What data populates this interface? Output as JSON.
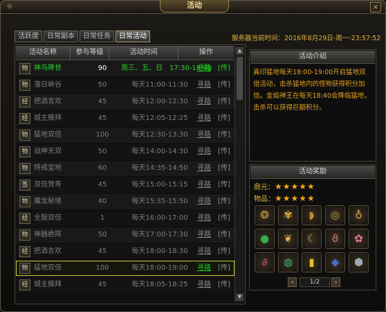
{
  "window": {
    "title": "活动",
    "close_label": "×"
  },
  "tabs": [
    {
      "label": "活跃度",
      "active": false
    },
    {
      "label": "日常副本",
      "active": false
    },
    {
      "label": "日常任务",
      "active": false
    },
    {
      "label": "日常活动",
      "active": true
    }
  ],
  "server_time": "服务器当前时间：2016年8月29日-周一-23:57:52",
  "list": {
    "headers": [
      "活动名称",
      "参与等级",
      "活动时间",
      "操作"
    ],
    "rows": [
      {
        "icon": "物",
        "name": "神鸟降世",
        "level": "90",
        "time": "周三、五、日　17:30-18:00",
        "find": "寻路",
        "send": "[传]",
        "state": "active"
      },
      {
        "icon": "物",
        "name": "落日峡谷",
        "level": "50",
        "time": "每天11:00-11:30",
        "find": "寻路",
        "send": "[传]",
        "state": "normal"
      },
      {
        "icon": "经",
        "name": "把酒言欢",
        "level": "45",
        "time": "每天12:00-12:30",
        "find": "寻路",
        "send": "[传]",
        "state": "normal"
      },
      {
        "icon": "经",
        "name": "城主膜拜",
        "level": "45",
        "time": "每天12:05-12:25",
        "find": "寻路",
        "send": "[传]",
        "state": "normal"
      },
      {
        "icon": "物",
        "name": "猛地双倍",
        "level": "100",
        "time": "每天12:30-13:30",
        "find": "寻路",
        "send": "[传]",
        "state": "normal"
      },
      {
        "icon": "物",
        "name": "战神无双",
        "level": "50",
        "time": "每天14:00-14:30",
        "find": "寻路",
        "send": "[传]",
        "state": "normal"
      },
      {
        "icon": "物",
        "name": "特戒宝地",
        "level": "60",
        "time": "每天14:35-14:50",
        "find": "寻路",
        "send": "[传]",
        "state": "normal"
      },
      {
        "icon": "签",
        "name": "双倍贺寿",
        "level": "45",
        "time": "每天15:00-15:15",
        "find": "寻路",
        "send": "[传]",
        "state": "normal"
      },
      {
        "icon": "物",
        "name": "魔龙秘境",
        "level": "40",
        "time": "每天15:35-15:50",
        "find": "寻路",
        "send": "[传]",
        "state": "normal"
      },
      {
        "icon": "经",
        "name": "全服双倍",
        "level": "1",
        "time": "每天16:00-17:00",
        "find": "寻路",
        "send": "[传]",
        "state": "normal"
      },
      {
        "icon": "物",
        "name": "神器绝阵",
        "level": "50",
        "time": "每天17:00-17:30",
        "find": "寻路",
        "send": "[传]",
        "state": "normal"
      },
      {
        "icon": "经",
        "name": "把酒言欢",
        "level": "45",
        "time": "每天18:00-18:30",
        "find": "寻路",
        "send": "[传]",
        "state": "normal"
      },
      {
        "icon": "物",
        "name": "猛地双倍",
        "level": "100",
        "time": "每天18:00-19:00",
        "find": "寻路",
        "send": "[传]",
        "state": "selected"
      },
      {
        "icon": "经",
        "name": "城主膜拜",
        "level": "45",
        "time": "每天18:05-18:25",
        "find": "寻路",
        "send": "[传]",
        "state": "normal"
      }
    ],
    "scroll_up": "▲",
    "scroll_down": "▼"
  },
  "intro": {
    "title": "活动介绍",
    "text": "真印猛地每天18:00-19:00开启猛地双倍活动，击杀猛地内的怪物获得积分加倍。金焰神王在每天18:40会降临猛地，击杀可以获得巨额积分。"
  },
  "reward": {
    "title": "活动奖励",
    "ratings": [
      {
        "label": "鼎元：",
        "stars": "★★★★★",
        "value": 5
      },
      {
        "label": "物品：",
        "stars": "★★★★★",
        "value": 5
      }
    ],
    "items": [
      {
        "icon": "amulet-icon",
        "glyph": "❂",
        "color": "#c99a3c"
      },
      {
        "icon": "gold-wing-icon",
        "glyph": "✾",
        "color": "#e0b23e"
      },
      {
        "icon": "bow-icon",
        "glyph": "◗",
        "color": "#c88a3a"
      },
      {
        "icon": "ring-icon",
        "glyph": "◎",
        "color": "#c8a04a"
      },
      {
        "icon": "necklace-icon",
        "glyph": "♁",
        "color": "#d6a94a"
      },
      {
        "icon": "green-orb-icon",
        "glyph": "●",
        "color": "#2fb04a"
      },
      {
        "icon": "wing-charm-icon",
        "glyph": "❦",
        "color": "#e2b455"
      },
      {
        "icon": "crescent-icon",
        "glyph": "☾",
        "color": "#c9a06a"
      },
      {
        "icon": "pink-pendant-icon",
        "glyph": "ϑ",
        "color": "#d8707a"
      },
      {
        "icon": "pink-flower-icon",
        "glyph": "✿",
        "color": "#e37aa8"
      },
      {
        "icon": "red-necklace-icon",
        "glyph": "∂",
        "color": "#d8506a"
      },
      {
        "icon": "green-gem-icon",
        "glyph": "◍",
        "color": "#32b86a"
      },
      {
        "icon": "gold-ingot-icon",
        "glyph": "▮",
        "color": "#e4c02a"
      },
      {
        "icon": "blue-stone-icon",
        "glyph": "◆",
        "color": "#4a6cc8"
      },
      {
        "icon": "silver-ore-icon",
        "glyph": "⬢",
        "color": "#9fa8b4"
      }
    ],
    "pager": {
      "prev": "«",
      "label": "1/2",
      "next": "»"
    }
  },
  "colors": {
    "accent_gold": "#e1b33b",
    "active_green": "#28d22b",
    "highlight_yellow": "#d4cf3c",
    "star_orange": "#f2a51c"
  }
}
